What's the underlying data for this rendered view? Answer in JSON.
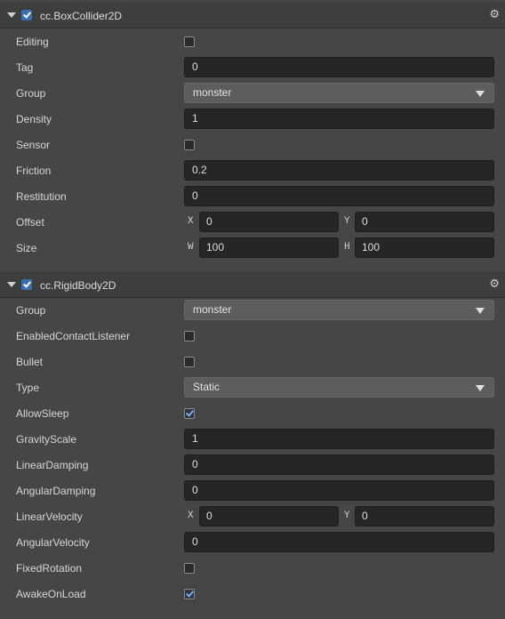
{
  "box_collider": {
    "title": "cc.BoxCollider2D",
    "enabled": true,
    "editing": {
      "label": "Editing",
      "checked": false
    },
    "tag": {
      "label": "Tag",
      "value": "0"
    },
    "group": {
      "label": "Group",
      "value": "monster"
    },
    "density": {
      "label": "Density",
      "value": "1"
    },
    "sensor": {
      "label": "Sensor",
      "checked": false
    },
    "friction": {
      "label": "Friction",
      "value": "0.2"
    },
    "restitution": {
      "label": "Restitution",
      "value": "0"
    },
    "offset": {
      "label": "Offset",
      "x_axis": "X",
      "x": "0",
      "y_axis": "Y",
      "y": "0"
    },
    "size": {
      "label": "Size",
      "w_axis": "W",
      "w": "100",
      "h_axis": "H",
      "h": "100"
    }
  },
  "rigid_body": {
    "title": "cc.RigidBody2D",
    "enabled": true,
    "group": {
      "label": "Group",
      "value": "monster"
    },
    "enabled_contact_listener": {
      "label": "EnabledContactListener",
      "checked": false
    },
    "bullet": {
      "label": "Bullet",
      "checked": false
    },
    "type": {
      "label": "Type",
      "value": "Static"
    },
    "allow_sleep": {
      "label": "AllowSleep",
      "checked": true
    },
    "gravity_scale": {
      "label": "GravityScale",
      "value": "1"
    },
    "linear_damping": {
      "label": "LinearDamping",
      "value": "0"
    },
    "angular_damping": {
      "label": "AngularDamping",
      "value": "0"
    },
    "linear_velocity": {
      "label": "LinearVelocity",
      "x_axis": "X",
      "x": "0",
      "y_axis": "Y",
      "y": "0"
    },
    "angular_velocity": {
      "label": "AngularVelocity",
      "value": "0"
    },
    "fixed_rotation": {
      "label": "FixedRotation",
      "checked": false
    },
    "awake_on_load": {
      "label": "AwakeOnLoad",
      "checked": true
    }
  },
  "icons": {
    "fold": "triangle-down-icon",
    "settings": "gear-icon",
    "dropdown": "dropdown-arrow-icon"
  },
  "colors": {
    "background": "#464646",
    "header": "#3e3e3e",
    "field": "#262626",
    "dropdown": "#5d5d5d",
    "accent": "#3a6fb0"
  }
}
